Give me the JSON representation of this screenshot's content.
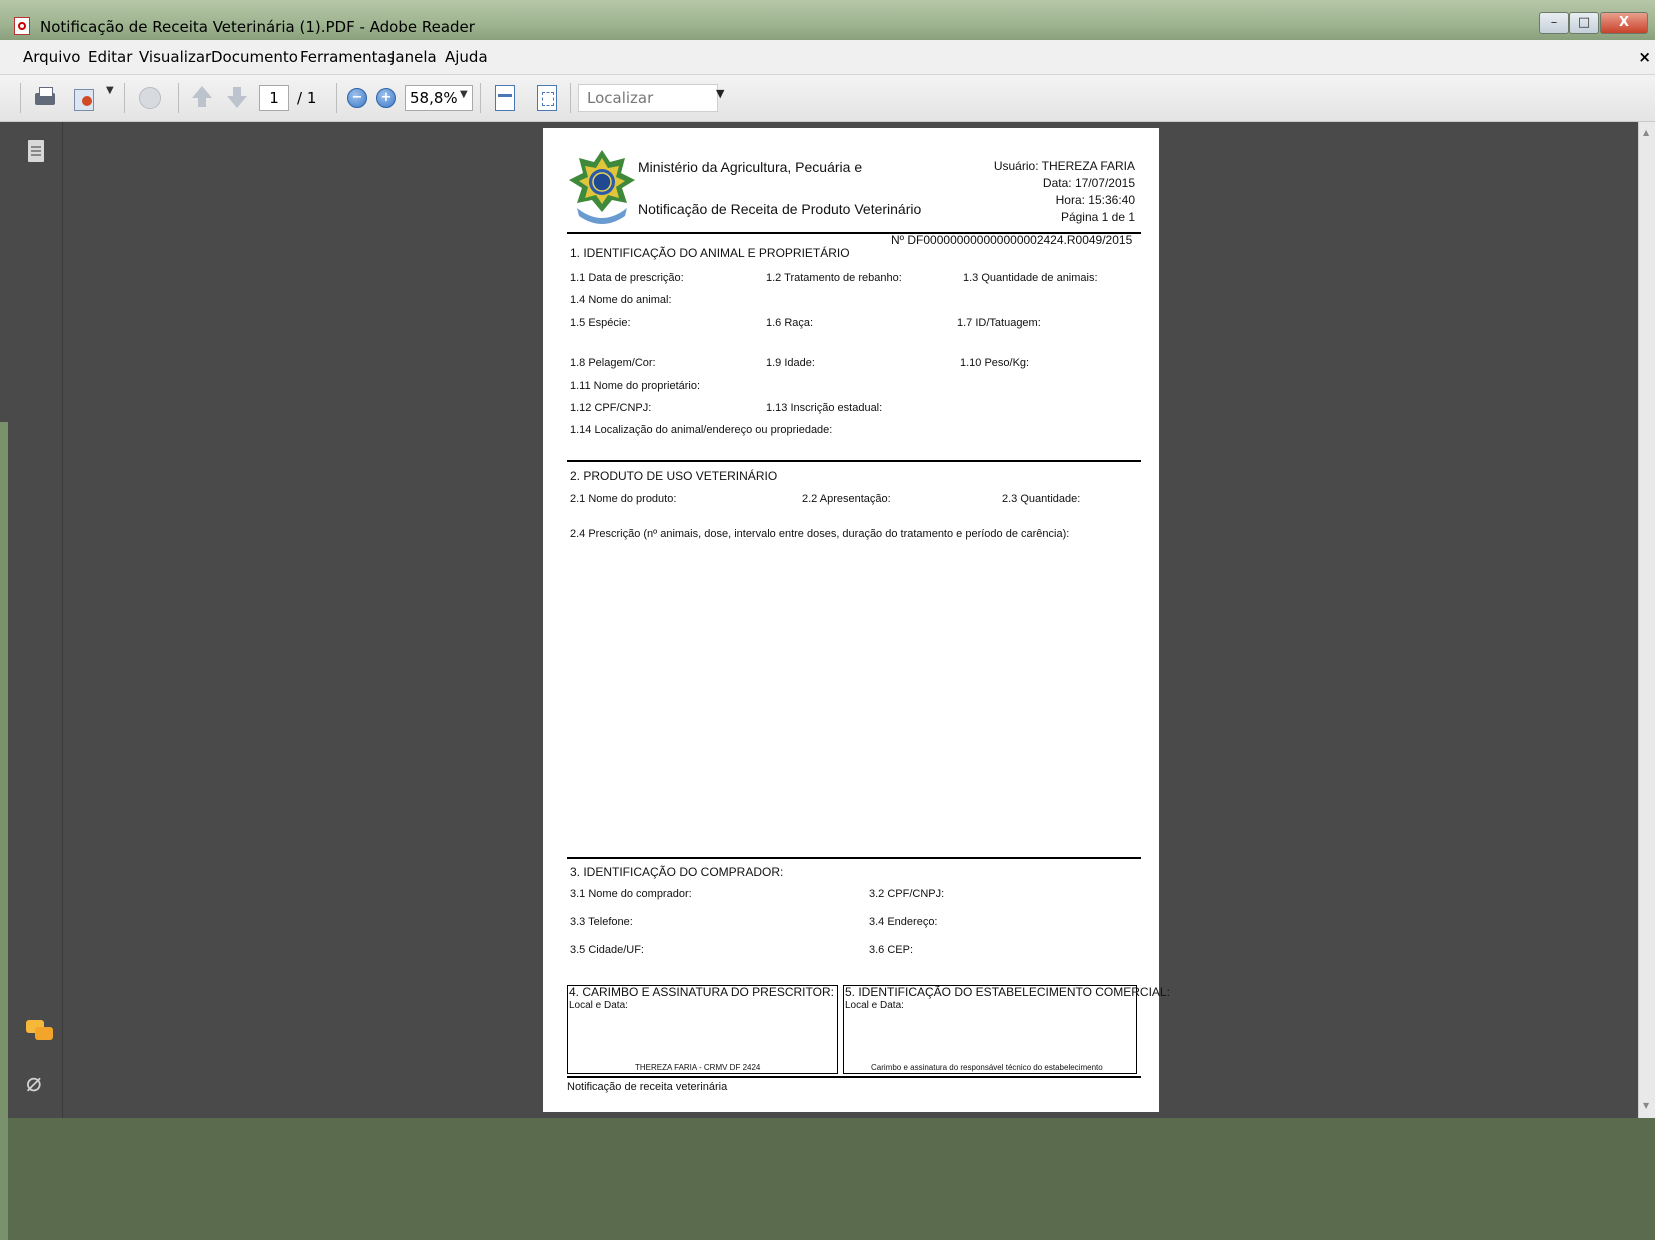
{
  "window": {
    "title": "Notificação de Receita Veterinária (1).PDF - Adobe Reader",
    "min": "–",
    "max": "□",
    "close": "X"
  },
  "menu": {
    "items": [
      "Arquivo",
      "Editar",
      "Visualizar",
      "Documento",
      "Ferramentas",
      "Janela",
      "Ajuda"
    ],
    "close": "×"
  },
  "toolbar": {
    "page_current": "1",
    "page_total": "/ 1",
    "zoom": "58,8%",
    "search_placeholder": "Localizar",
    "zoom_out": "−",
    "zoom_in": "+"
  },
  "doc": {
    "header": {
      "ministry": "Ministério da Agricultura, Pecuária e",
      "title": "Notificação de Receita de Produto Veterinário",
      "user": "Usuário: THEREZA FARIA",
      "date": "Data: 17/07/2015",
      "time": "Hora: 15:36:40",
      "page": "Página 1 de  1",
      "number": "Nº  DF000000000000000002424.R0049/2015"
    },
    "s1": {
      "title": "1. IDENTIFICAÇÃO DO ANIMAL E PROPRIETÁRIO",
      "f1_1": "1.1 Data de prescrição:",
      "f1_2": "1.2 Tratamento de rebanho:",
      "f1_3": "1.3 Quantidade de animais:",
      "f1_4": "1.4 Nome do animal:",
      "f1_5": "1.5 Espécie:",
      "f1_6": "1.6 Raça:",
      "f1_7": "1.7 ID/Tatuagem:",
      "f1_8": "1.8 Pelagem/Cor:",
      "f1_9": "1.9 Idade:",
      "f1_10": "1.10 Peso/Kg:",
      "f1_11": "1.11 Nome do proprietário:",
      "f1_12": "1.12 CPF/CNPJ:",
      "f1_13": "1.13 Inscrição estadual:",
      "f1_14": "1.14 Localização do animal/endereço ou propriedade:"
    },
    "s2": {
      "title": "2. PRODUTO DE USO VETERINÁRIO",
      "f2_1": "2.1 Nome do produto:",
      "f2_2": "2.2 Apresentação:",
      "f2_3": "2.3 Quantidade:",
      "f2_4": "2.4 Prescrição (nº animais, dose, intervalo entre doses, duração do tratamento e período de carência):"
    },
    "s3": {
      "title": "3. IDENTIFICAÇÃO DO COMPRADOR:",
      "f3_1": "3.1 Nome do comprador:",
      "f3_2": "3.2 CPF/CNPJ:",
      "f3_3": "3.3 Telefone:",
      "f3_4": "3.4 Endereço:",
      "f3_5": "3.5 Cidade/UF:",
      "f3_6": "3.6 CEP:"
    },
    "s4": {
      "title": "4. CARIMBO E ASSINATURA DO PRESCRITOR:",
      "local": "Local e Data:",
      "signer": "THEREZA FARIA - CRMV DF 2424"
    },
    "s5": {
      "title": "5. IDENTIFICAÇÃO DO ESTABELECIMENTO COMERCIAL:",
      "local": "Local e Data:",
      "caption": "Carimbo e assinatura do responsável técnico do estabelecimento"
    },
    "footer": "Notificação de receita veterinária"
  },
  "icons": {
    "app": "adobe-reader-icon",
    "print": "printer-icon",
    "share": "share-icon",
    "globe": "globe-icon",
    "pages": "pages-panel-icon",
    "comments": "comments-icon",
    "attach": "paperclip-icon"
  }
}
